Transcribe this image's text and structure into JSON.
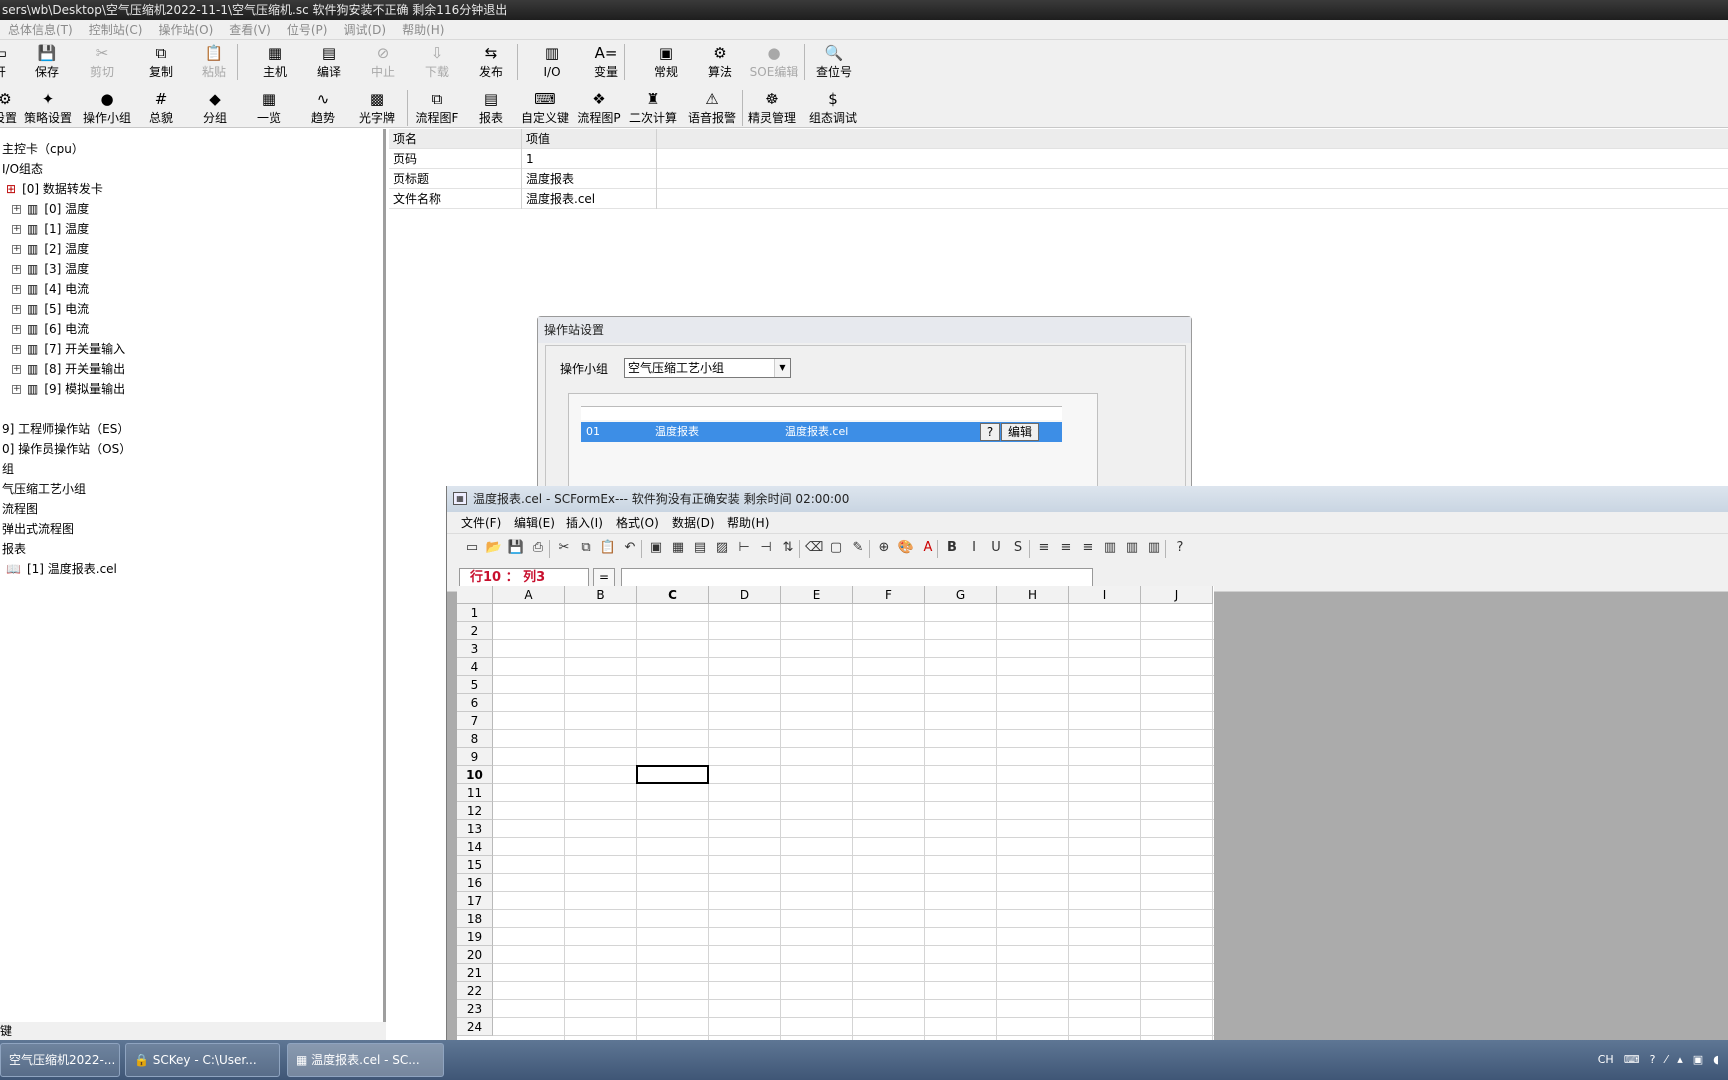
{
  "window": {
    "title": "sers\\wb\\Desktop\\空气压缩机2022-11-1\\空气压缩机.sc        软件狗安装不正确  剩余116分钟退出"
  },
  "menubar": [
    "总体信息(T)",
    "控制站(C)",
    "操作站(O)",
    "查看(V)",
    "位号(P)",
    "调试(D)",
    "帮助(H)"
  ],
  "toolbar1": [
    {
      "label": "开",
      "icon": "open-icon",
      "glyph": "▭",
      "disabled": false
    },
    {
      "label": "保存",
      "icon": "save-icon",
      "glyph": "💾",
      "disabled": false
    },
    {
      "label": "剪切",
      "icon": "cut-icon",
      "glyph": "✂",
      "disabled": true
    },
    {
      "label": "复制",
      "icon": "copy-icon",
      "glyph": "⧉",
      "disabled": false
    },
    {
      "label": "粘贴",
      "icon": "paste-icon",
      "glyph": "📋",
      "disabled": true
    },
    {
      "label": "主机",
      "icon": "host-icon",
      "glyph": "▦",
      "disabled": false
    },
    {
      "label": "编译",
      "icon": "compile-icon",
      "glyph": "▤",
      "disabled": false
    },
    {
      "label": "中止",
      "icon": "abort-icon",
      "glyph": "⊘",
      "disabled": true
    },
    {
      "label": "下载",
      "icon": "download-icon",
      "glyph": "⇩",
      "disabled": true
    },
    {
      "label": "发布",
      "icon": "publish-icon",
      "glyph": "⇆",
      "disabled": false
    },
    {
      "label": "I/O",
      "icon": "io-icon",
      "glyph": "▥",
      "disabled": false
    },
    {
      "label": "变量",
      "icon": "variable-icon",
      "glyph": "A=",
      "disabled": false
    },
    {
      "label": "常规",
      "icon": "general-icon",
      "glyph": "▣",
      "disabled": false
    },
    {
      "label": "算法",
      "icon": "algorithm-icon",
      "glyph": "⚙",
      "disabled": false
    },
    {
      "label": "SOE编辑",
      "icon": "soe-icon",
      "glyph": "●",
      "disabled": true
    },
    {
      "label": "查位号",
      "icon": "find-tag-icon",
      "glyph": "🔍",
      "disabled": false
    }
  ],
  "toolbar2": [
    {
      "label": "设置",
      "icon": "settings-icon",
      "glyph": "⚙"
    },
    {
      "label": "策略设置",
      "icon": "strategy-icon",
      "glyph": "✦"
    },
    {
      "label": "操作小组",
      "icon": "op-group-icon",
      "glyph": "●"
    },
    {
      "label": "总貌",
      "icon": "overview-icon",
      "glyph": "#"
    },
    {
      "label": "分组",
      "icon": "group-icon",
      "glyph": "◆"
    },
    {
      "label": "一览",
      "icon": "list-icon",
      "glyph": "▦"
    },
    {
      "label": "趋势",
      "icon": "trend-icon",
      "glyph": "∿"
    },
    {
      "label": "光字牌",
      "icon": "annunciator-icon",
      "glyph": "▩"
    },
    {
      "label": "流程图F",
      "icon": "flowchart-f-icon",
      "glyph": "⧉"
    },
    {
      "label": "报表",
      "icon": "report-icon",
      "glyph": "▤"
    },
    {
      "label": "自定义键",
      "icon": "custom-key-icon",
      "glyph": "⌨"
    },
    {
      "label": "流程图P",
      "icon": "flowchart-p-icon",
      "glyph": "❖"
    },
    {
      "label": "二次计算",
      "icon": "secondary-calc-icon",
      "glyph": "♜"
    },
    {
      "label": "语音报警",
      "icon": "voice-alarm-icon",
      "glyph": "⚠"
    },
    {
      "label": "精灵管理",
      "icon": "sprite-icon",
      "glyph": "☸"
    },
    {
      "label": "组态调试",
      "icon": "config-debug-icon",
      "glyph": "$"
    }
  ],
  "tree": {
    "items": [
      {
        "label": "主控卡（cpu）",
        "type": "text"
      },
      {
        "label": "I/O组态",
        "type": "text"
      },
      {
        "label": "[0] 数据转发卡",
        "type": "root"
      },
      {
        "label": "[0] 温度",
        "type": "card"
      },
      {
        "label": "[1] 温度",
        "type": "card"
      },
      {
        "label": "[2] 温度",
        "type": "card"
      },
      {
        "label": "[3] 温度",
        "type": "card"
      },
      {
        "label": "[4] 电流",
        "type": "card"
      },
      {
        "label": "[5] 电流",
        "type": "card"
      },
      {
        "label": "[6] 电流",
        "type": "card"
      },
      {
        "label": "[7] 开关量输入",
        "type": "card"
      },
      {
        "label": "[8] 开关量输出",
        "type": "card"
      },
      {
        "label": "[9] 模拟量输出",
        "type": "card"
      },
      {
        "label": "",
        "type": "blank"
      },
      {
        "label": "9] 工程师操作站（ES）",
        "type": "text"
      },
      {
        "label": "0] 操作员操作站（OS）",
        "type": "text"
      },
      {
        "label": "组",
        "type": "text"
      },
      {
        "label": "气压缩工艺小组",
        "type": "text"
      },
      {
        "label": "流程图",
        "type": "text"
      },
      {
        "label": "弹出式流程图",
        "type": "text"
      },
      {
        "label": "报表",
        "type": "text"
      },
      {
        "label": "[1] 温度报表.cel",
        "type": "file"
      }
    ],
    "bottom": "键"
  },
  "property_grid": {
    "headers": [
      "项名",
      "项值"
    ],
    "rows": [
      [
        "页码",
        "1"
      ],
      [
        "页标题",
        "温度报表"
      ],
      [
        "文件名称",
        "温度报表.cel"
      ]
    ]
  },
  "op_dialog": {
    "title": "操作站设置",
    "group_label": "操作小组",
    "group_value": "空气压缩工艺小组",
    "row": {
      "no": "01",
      "title": "温度报表",
      "file": "温度报表.cel"
    },
    "q_label": "?",
    "edit_label": "编辑"
  },
  "form_window": {
    "title": "温度报表.cel - SCFormEx--- 软件狗没有正确安装 剩余时间 02:00:00",
    "menu": [
      "文件(F)",
      "编辑(E)",
      "插入(I)",
      "格式(O)",
      "数据(D)",
      "帮助(H)"
    ],
    "cell_ref": "行10 ： 列3",
    "eq": "=",
    "columns": [
      "A",
      "B",
      "C",
      "D",
      "E",
      "F",
      "G",
      "H",
      "I",
      "J"
    ],
    "rows": [
      "1",
      "2",
      "3",
      "4",
      "5",
      "6",
      "7",
      "8",
      "9",
      "10",
      "11",
      "12",
      "13",
      "14",
      "15",
      "16",
      "17",
      "18",
      "19",
      "20",
      "21",
      "22",
      "23",
      "24"
    ],
    "active_row": 10,
    "active_col": 3
  },
  "taskbar": {
    "tasks": [
      "空气压缩机2022-...",
      "SCKey - C:\\User...",
      "温度报表.cel - SC..."
    ],
    "tray": [
      "CH",
      "⌨",
      "?",
      "⁄",
      "▴",
      "▣",
      "◖"
    ]
  }
}
